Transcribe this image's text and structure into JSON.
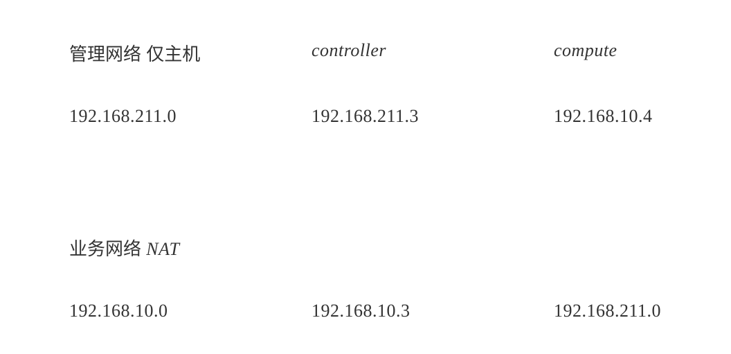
{
  "headers": {
    "network_label": "管理网络  仅主机",
    "controller": "controller",
    "compute": "compute"
  },
  "management_network": {
    "label": "管理网络  仅主机",
    "subnet": "192.168.211.0",
    "controller_ip": "192.168.211.3",
    "compute_ip": "192.168.10.4"
  },
  "business_network": {
    "label": "业务网络  NAT",
    "subnet": "192.168.10.0",
    "controller_ip": "192.168.10.3",
    "compute_ip": "192.168.211.0"
  }
}
